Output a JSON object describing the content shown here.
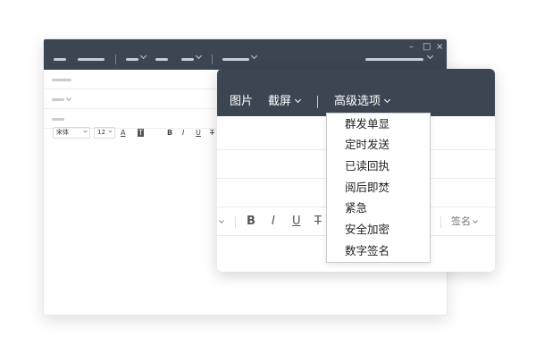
{
  "front_toolbar": {
    "image_label": "图片",
    "screenshot_label": "截屏",
    "advanced_label": "高级选项"
  },
  "advanced_menu": {
    "items": [
      "群发单显",
      "定时发送",
      "已读回执",
      "阅后即焚",
      "紧急",
      "安全加密",
      "数字签名"
    ]
  },
  "front_format": {
    "bold": "B",
    "italic": "I",
    "underline": "U",
    "strike": "T",
    "signature_label": "签名"
  },
  "back_format": {
    "font_value": "宋体",
    "size_value": "12",
    "font_color_glyph": "A",
    "bg_color_glyph": "T",
    "bold": "B",
    "italic": "I",
    "underline": "U",
    "strike": "T"
  },
  "window_controls": {
    "minimize": "–",
    "maximize": "□",
    "close": "×"
  },
  "colors": {
    "titlebar": "#3c4652",
    "menu_border": "#c9ced6"
  }
}
